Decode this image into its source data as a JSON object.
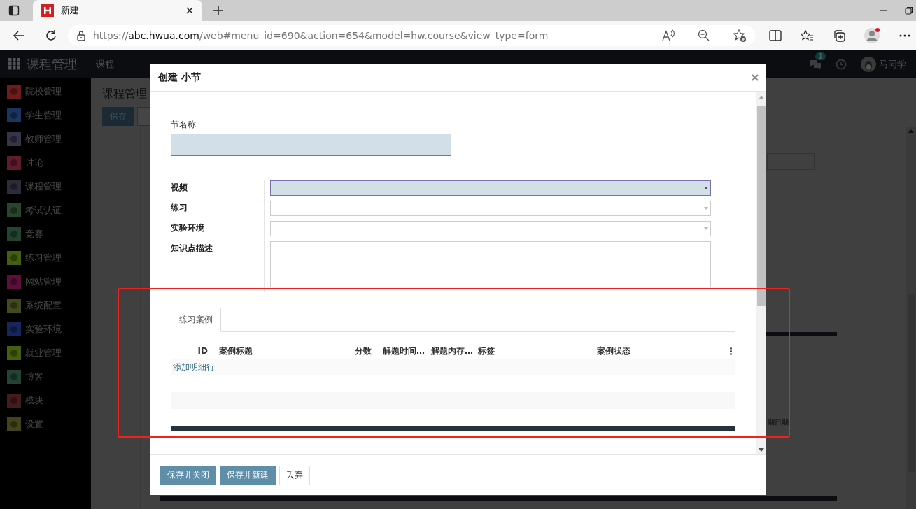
{
  "browser": {
    "tab": {
      "title": "新建",
      "selected": true
    },
    "url": {
      "scheme": "https://",
      "host": "abc.hwua.com",
      "path": "/web#menu_id=690&action=654&model=hw.course&view_type=form"
    }
  },
  "app": {
    "brand": "课程管理",
    "menu": [
      "课程"
    ],
    "notifications": "1",
    "user": "马同学"
  },
  "sidebar": {
    "items": [
      {
        "label": "院校管理",
        "color": "#6e1c1c"
      },
      {
        "label": "学生管理",
        "color": "#1c3560"
      },
      {
        "label": "教师管理",
        "color": "#34344a"
      },
      {
        "label": "讨论",
        "color": "#5e1c2c"
      },
      {
        "label": "课程管理",
        "color": "#2c2c3a"
      },
      {
        "label": "考试认证",
        "color": "#28462c"
      },
      {
        "label": "竞赛",
        "color": "#244432"
      },
      {
        "label": "练习管理",
        "color": "#44600e"
      },
      {
        "label": "网站管理",
        "color": "#5e0e3a"
      },
      {
        "label": "系统配置",
        "color": "#444a1c"
      },
      {
        "label": "实验环境",
        "color": "#182660"
      },
      {
        "label": "就业管理",
        "color": "#44600e"
      },
      {
        "label": "博客",
        "color": "#244432"
      },
      {
        "label": "模块",
        "color": "#441c1c"
      },
      {
        "label": "设置",
        "color": "#44441c"
      }
    ]
  },
  "page": {
    "breadcrumb": "课程管理",
    "buttons": [
      {
        "label": "保存",
        "kind": "primary"
      }
    ],
    "fragment": "期日期"
  },
  "dialog": {
    "title": "创建 小节",
    "name_field": {
      "label": "节名称",
      "required": true
    },
    "fields": [
      {
        "label": "视频",
        "kind": "select",
        "required": true
      },
      {
        "label": "练习",
        "kind": "select",
        "required": false
      },
      {
        "label": "实验环境",
        "kind": "select",
        "required": false
      },
      {
        "label": "知识点描述",
        "kind": "textarea",
        "required": false
      }
    ],
    "tabs": [
      {
        "label": "练习案例",
        "selected": true
      }
    ],
    "table": {
      "columns": [
        {
          "label": "ID",
          "kind": "number"
        },
        {
          "label": "案例标题",
          "kind": "text"
        },
        {
          "label": "分数",
          "kind": "number"
        },
        {
          "label": "解题时间…",
          "kind": "text"
        },
        {
          "label": "解题内存…",
          "kind": "text"
        },
        {
          "label": "标签",
          "kind": "text"
        },
        {
          "label": "案例状态",
          "kind": "text"
        }
      ],
      "add_row": "添加明细行"
    },
    "buttons": [
      {
        "label": "保存并关闭",
        "kind": "primary"
      },
      {
        "label": "保存并新建",
        "kind": "primary"
      },
      {
        "label": "丢弃",
        "kind": "secondary"
      }
    ]
  },
  "annotation": {
    "kind": "frame"
  }
}
